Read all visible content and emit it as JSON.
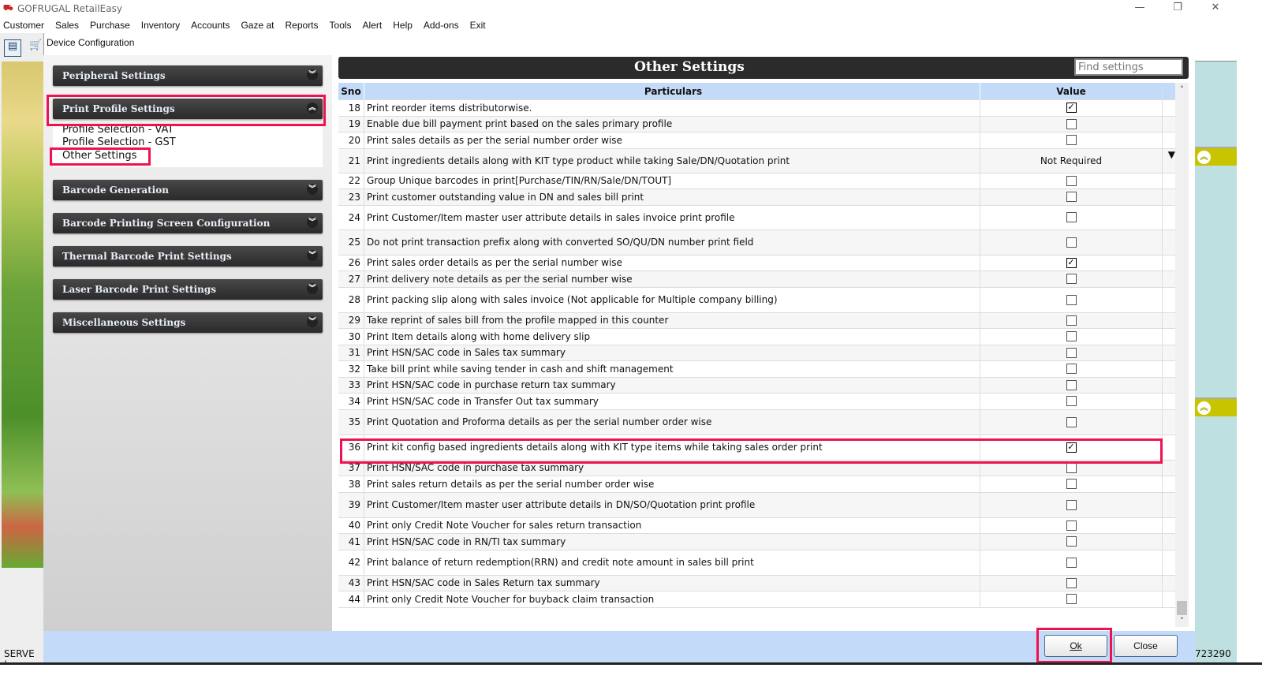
{
  "app": {
    "title": "GOFRUGAL RetailEasy",
    "logo": "RE"
  },
  "menu": [
    "Customer",
    "Sales",
    "Purchase",
    "Inventory",
    "Accounts",
    "Gaze at",
    "Reports",
    "Tools",
    "Alert",
    "Help",
    "Add-ons",
    "Exit"
  ],
  "dialog": {
    "title": "Device Configuration"
  },
  "sidebar": {
    "sections": [
      "Peripheral Settings",
      "Print Profile Settings",
      "Barcode Generation",
      "Barcode Printing Screen Configuration",
      "Thermal Barcode Print Settings",
      "Laser Barcode Print Settings",
      "Miscellaneous Settings"
    ],
    "print_profile_items": [
      "Profile Selection - VAT",
      "Profile Selection - GST",
      "Other Settings"
    ]
  },
  "main": {
    "title": "Other Settings",
    "search_placeholder": "Find settings",
    "columns": {
      "sno": "Sno",
      "particulars": "Particulars",
      "value": "Value"
    },
    "rows": [
      {
        "sno": "18",
        "text": "Print reorder items distributorwise.",
        "type": "check",
        "checked": true
      },
      {
        "sno": "19",
        "text": "Enable due bill payment print based on the sales primary profile",
        "type": "check",
        "checked": false
      },
      {
        "sno": "20",
        "text": "Print sales details as per the serial number order wise",
        "type": "check",
        "checked": false
      },
      {
        "sno": "21",
        "text": "Print ingredients details along with KIT type product while taking Sale/DN/Quotation print",
        "type": "select",
        "value": "Not Required"
      },
      {
        "sno": "22",
        "text": "Group Unique barcodes in print[Purchase/TIN/RN/Sale/DN/TOUT]",
        "type": "check",
        "checked": false
      },
      {
        "sno": "23",
        "text": "Print customer outstanding value in DN and sales bill print",
        "type": "check",
        "checked": false
      },
      {
        "sno": "24",
        "text": "Print Customer/Item master user attribute details in sales invoice print profile",
        "type": "check",
        "checked": false
      },
      {
        "sno": "25",
        "text": "Do not print transaction prefix along with converted SO/QU/DN number print field",
        "type": "check",
        "checked": false
      },
      {
        "sno": "26",
        "text": "Print sales order details as per the serial number wise",
        "type": "check",
        "checked": true
      },
      {
        "sno": "27",
        "text": "Print delivery note details as per the serial number wise",
        "type": "check",
        "checked": false
      },
      {
        "sno": "28",
        "text": "Print packing slip along with sales invoice (Not applicable for  Multiple company billing)",
        "type": "check",
        "checked": false
      },
      {
        "sno": "29",
        "text": "Take reprint of sales bill from the profile mapped in this counter",
        "type": "check",
        "checked": false
      },
      {
        "sno": "30",
        "text": "Print Item details along with home delivery slip",
        "type": "check",
        "checked": false
      },
      {
        "sno": "31",
        "text": "Print HSN/SAC code in Sales tax summary",
        "type": "check",
        "checked": false
      },
      {
        "sno": "32",
        "text": "Take bill print while saving tender in cash and shift management",
        "type": "check",
        "checked": false
      },
      {
        "sno": "33",
        "text": "Print HSN/SAC code in purchase return tax summary",
        "type": "check",
        "checked": false
      },
      {
        "sno": "34",
        "text": "Print HSN/SAC code in Transfer Out tax summary",
        "type": "check",
        "checked": false
      },
      {
        "sno": "35",
        "text": "Print Quotation and Proforma details as per the serial number order wise",
        "type": "check",
        "checked": false
      },
      {
        "sno": "36",
        "text": "Print kit config based ingredients details along with KIT type items while taking sales order print",
        "type": "check",
        "checked": true
      },
      {
        "sno": "37",
        "text": "Print HSN/SAC code in purchase tax summary",
        "type": "check",
        "checked": false
      },
      {
        "sno": "38",
        "text": "Print sales return details as per the serial number order wise",
        "type": "check",
        "checked": false
      },
      {
        "sno": "39",
        "text": "Print Customer/Item master user attribute details in DN/SO/Quotation print profile",
        "type": "check",
        "checked": false
      },
      {
        "sno": "40",
        "text": "Print only Credit Note Voucher for sales return transaction",
        "type": "check",
        "checked": false
      },
      {
        "sno": "41",
        "text": "Print HSN/SAC code in RN/TI tax summary",
        "type": "check",
        "checked": false
      },
      {
        "sno": "42",
        "text": "Print balance of return redemption(RRN) and credit note amount in sales bill print",
        "type": "check",
        "checked": false
      },
      {
        "sno": "43",
        "text": "Print HSN/SAC code in Sales Return tax summary",
        "type": "check",
        "checked": false
      },
      {
        "sno": "44",
        "text": "Print only Credit Note Voucher for buyback claim transaction",
        "type": "check",
        "checked": false
      }
    ]
  },
  "buttons": {
    "ok": "Ok",
    "close": "Close"
  },
  "status": {
    "left": "SERVE |",
    "right": "723290"
  },
  "colors": {
    "highlight": "#f0114e",
    "header": "#2b2b2b",
    "column_header": "#c3dbf8"
  }
}
